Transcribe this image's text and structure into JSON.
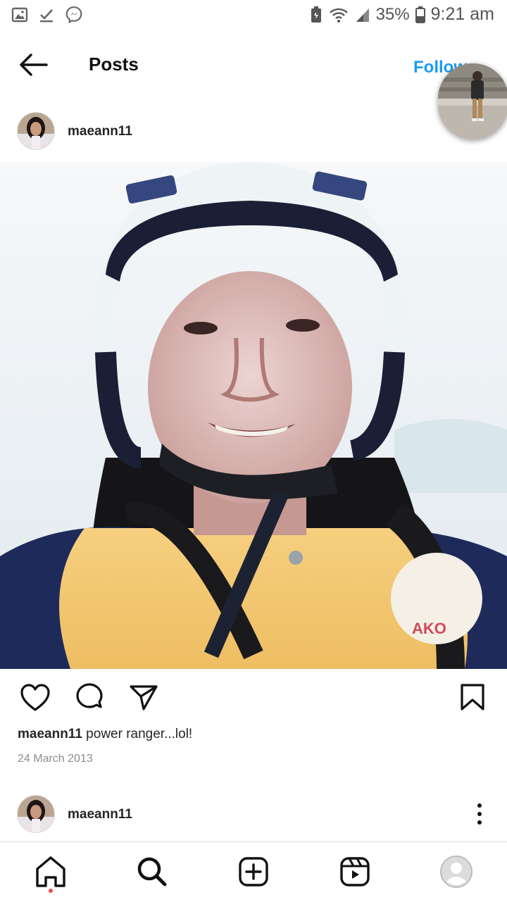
{
  "status_bar": {
    "battery": "35%",
    "time": "9:21 am"
  },
  "header": {
    "title": "Posts",
    "follow_label": "Follow"
  },
  "post": {
    "username": "maeann11",
    "caption_user": "maeann11",
    "caption_text": " power ranger...lol!",
    "date": "24 March 2013"
  },
  "next_post": {
    "username": "maeann11"
  },
  "nav": {
    "items": [
      "home-icon",
      "search-icon",
      "new-post-icon",
      "reels-icon",
      "profile-icon"
    ]
  },
  "colors": {
    "follow": "#1c9bf0",
    "notification_dot": "#ed4956",
    "text": "#262626",
    "date": "#8e8e8e"
  }
}
